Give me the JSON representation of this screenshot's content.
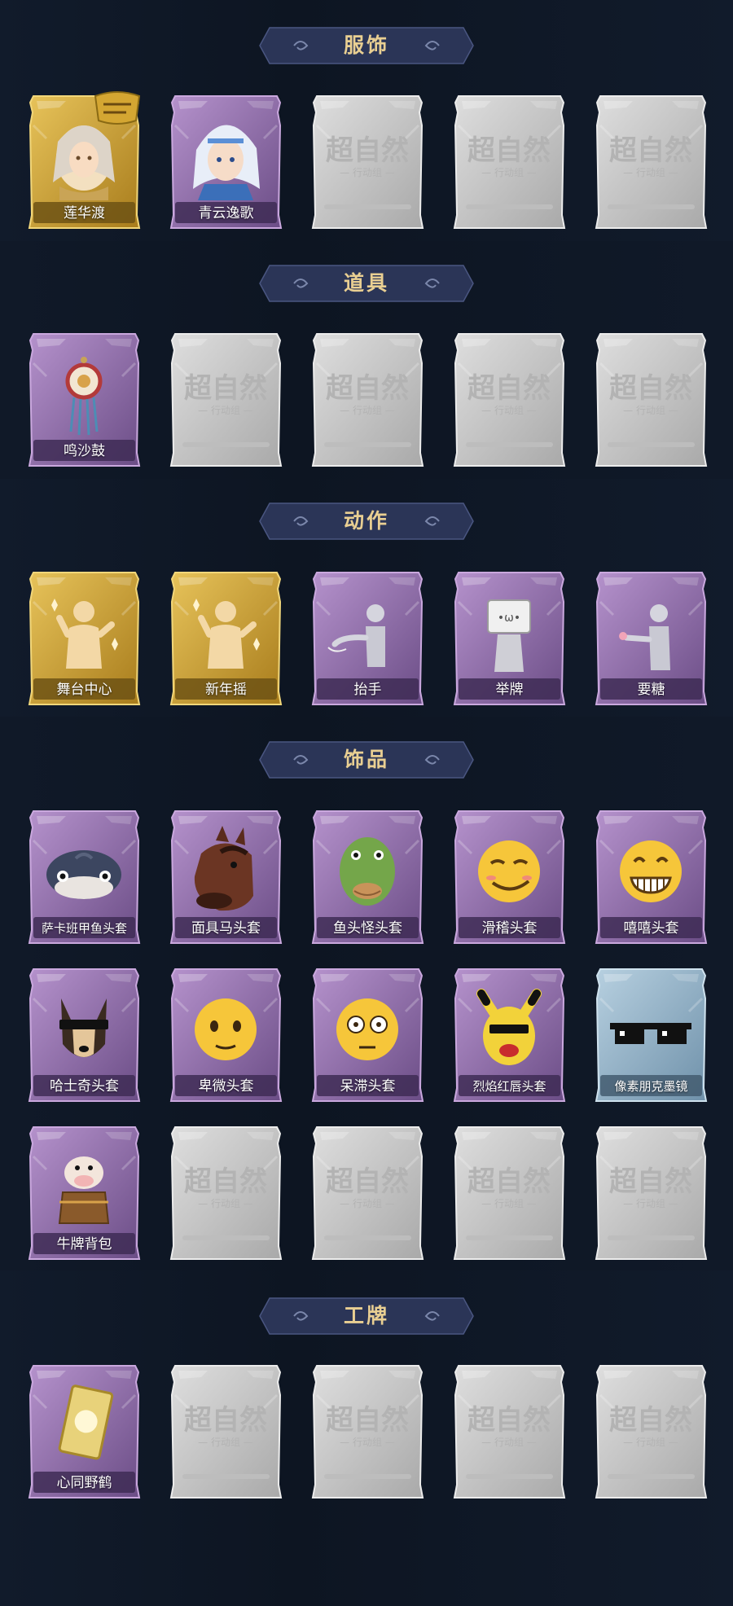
{
  "sections": [
    {
      "title": "服饰",
      "items": [
        {
          "label": "莲华渡",
          "rarity": "gold",
          "icon": "costume-lotus-icon",
          "badge": "tag-badge-icon"
        },
        {
          "label": "青云逸歌",
          "rarity": "purple",
          "icon": "costume-silver-hair-icon"
        },
        {
          "label": "",
          "rarity": "locked",
          "icon": "locked-placeholder-icon"
        },
        {
          "label": "",
          "rarity": "locked",
          "icon": "locked-placeholder-icon"
        },
        {
          "label": "",
          "rarity": "locked",
          "icon": "locked-placeholder-icon"
        }
      ]
    },
    {
      "title": "道具",
      "items": [
        {
          "label": "鸣沙鼓",
          "rarity": "purple",
          "icon": "drum-icon"
        },
        {
          "label": "",
          "rarity": "locked",
          "icon": "locked-placeholder-icon"
        },
        {
          "label": "",
          "rarity": "locked",
          "icon": "locked-placeholder-icon"
        },
        {
          "label": "",
          "rarity": "locked",
          "icon": "locked-placeholder-icon"
        },
        {
          "label": "",
          "rarity": "locked",
          "icon": "locked-placeholder-icon"
        }
      ]
    },
    {
      "title": "动作",
      "items": [
        {
          "label": "舞台中心",
          "rarity": "gold",
          "icon": "pose-figure-icon"
        },
        {
          "label": "新年摇",
          "rarity": "gold",
          "icon": "pose-figure-icon"
        },
        {
          "label": "抬手",
          "rarity": "purple",
          "icon": "pose-raise-hand-icon"
        },
        {
          "label": "举牌",
          "rarity": "purple",
          "icon": "pose-sign-icon"
        },
        {
          "label": "要糖",
          "rarity": "purple",
          "icon": "pose-candy-icon"
        }
      ]
    },
    {
      "title": "饰品",
      "items": [
        {
          "label": "萨卡班甲鱼头套",
          "rarity": "purple",
          "icon": "fish-head-icon"
        },
        {
          "label": "面具马头套",
          "rarity": "purple",
          "icon": "horse-head-icon"
        },
        {
          "label": "鱼头怪头套",
          "rarity": "purple",
          "icon": "green-fish-head-icon"
        },
        {
          "label": "滑稽头套",
          "rarity": "purple",
          "icon": "smirk-emoji-icon"
        },
        {
          "label": "嘻嘻头套",
          "rarity": "purple",
          "icon": "grin-emoji-icon"
        },
        {
          "label": "哈士奇头套",
          "rarity": "purple",
          "icon": "husky-head-icon"
        },
        {
          "label": "卑微头套",
          "rarity": "purple",
          "icon": "pleading-emoji-icon"
        },
        {
          "label": "呆滞头套",
          "rarity": "purple",
          "icon": "stunned-emoji-icon"
        },
        {
          "label": "烈焰红唇头套",
          "rarity": "purple",
          "icon": "pikachu-head-icon"
        },
        {
          "label": "像素朋克墨镜",
          "rarity": "blue",
          "icon": "pixel-sunglasses-icon"
        },
        {
          "label": "牛牌背包",
          "rarity": "purple",
          "icon": "cow-backpack-icon"
        },
        {
          "label": "",
          "rarity": "locked",
          "icon": "locked-placeholder-icon"
        },
        {
          "label": "",
          "rarity": "locked",
          "icon": "locked-placeholder-icon"
        },
        {
          "label": "",
          "rarity": "locked",
          "icon": "locked-placeholder-icon"
        },
        {
          "label": "",
          "rarity": "locked",
          "icon": "locked-placeholder-icon"
        }
      ]
    },
    {
      "title": "工牌",
      "items": [
        {
          "label": "心同野鹤",
          "rarity": "purple",
          "icon": "badge-card-icon"
        },
        {
          "label": "",
          "rarity": "locked",
          "icon": "locked-placeholder-icon"
        },
        {
          "label": "",
          "rarity": "locked",
          "icon": "locked-placeholder-icon"
        },
        {
          "label": "",
          "rarity": "locked",
          "icon": "locked-placeholder-icon"
        },
        {
          "label": "",
          "rarity": "locked",
          "icon": "locked-placeholder-icon"
        }
      ]
    }
  ],
  "locked_watermark": {
    "main": "超自然",
    "sub": "行动组"
  },
  "colors": {
    "background": "#0d1522",
    "header_bg": "#2b3557",
    "header_text": "#e9cf92",
    "gold": "#c9a02e",
    "purple": "#8c6aa6",
    "blue": "#8fb4cc",
    "locked": "#c8c8c8"
  }
}
